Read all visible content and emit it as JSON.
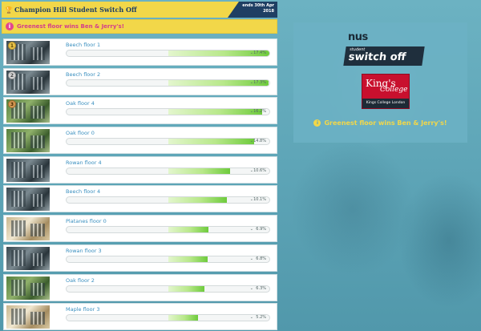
{
  "header": {
    "title": "Champion Hill Student Switch Off",
    "ends_line1": "ends 30th Apr",
    "ends_line2": "2018"
  },
  "prize_banner": {
    "info_icon": "i",
    "text": "Greenest floor wins Ben & Jerry's!"
  },
  "rows": [
    {
      "name": "Beech floor 1",
      "value": "17.4%",
      "percent": 100,
      "medal": "1",
      "medal_type": "gold",
      "thumb": "t-dark"
    },
    {
      "name": "Beech floor 2",
      "value": "17.3%",
      "percent": 99,
      "medal": "2",
      "medal_type": "silver",
      "thumb": "t-dark"
    },
    {
      "name": "Oak floor 4",
      "value": "16.2%",
      "percent": 93,
      "medal": "3",
      "medal_type": "bronze",
      "thumb": "t-green"
    },
    {
      "name": "Oak floor 0",
      "value": "14.8%",
      "percent": 85,
      "medal": "",
      "medal_type": "",
      "thumb": "t-green"
    },
    {
      "name": "Rowan floor 4",
      "value": "10.6%",
      "percent": 61,
      "medal": "",
      "medal_type": "",
      "thumb": "t-dark"
    },
    {
      "name": "Beech floor 4",
      "value": "10.1%",
      "percent": 58,
      "medal": "",
      "medal_type": "",
      "thumb": "t-dark"
    },
    {
      "name": "Platanes floor 0",
      "value": "6.9%",
      "percent": 40,
      "medal": "",
      "medal_type": "",
      "thumb": "t-light"
    },
    {
      "name": "Rowan floor 3",
      "value": "6.8%",
      "percent": 39,
      "medal": "",
      "medal_type": "",
      "thumb": "t-dark"
    },
    {
      "name": "Oak floor 2",
      "value": "6.3%",
      "percent": 36,
      "medal": "",
      "medal_type": "",
      "thumb": "t-green"
    },
    {
      "name": "Maple floor 3",
      "value": "5.2%",
      "percent": 30,
      "medal": "",
      "medal_type": "",
      "thumb": "t-light"
    }
  ],
  "panel": {
    "nus_logo": "nus",
    "switch_off_small": "student",
    "switch_off_big": "switch off",
    "kcl_k1": "King's",
    "kcl_k2": "College",
    "kcl_k3": "Kings College London",
    "prize_text": "Greenest floor wins Ben & Jerry's!"
  },
  "colors": {
    "accent_yellow": "#f2d749",
    "navy": "#1f3f63",
    "pink": "#e2468f",
    "bar_green": "#6ecb3c",
    "link_blue": "#3a8fbf"
  },
  "icons": [
    "trophy-icon",
    "info-icon",
    "chevron-down-icon",
    "medal-icon"
  ]
}
